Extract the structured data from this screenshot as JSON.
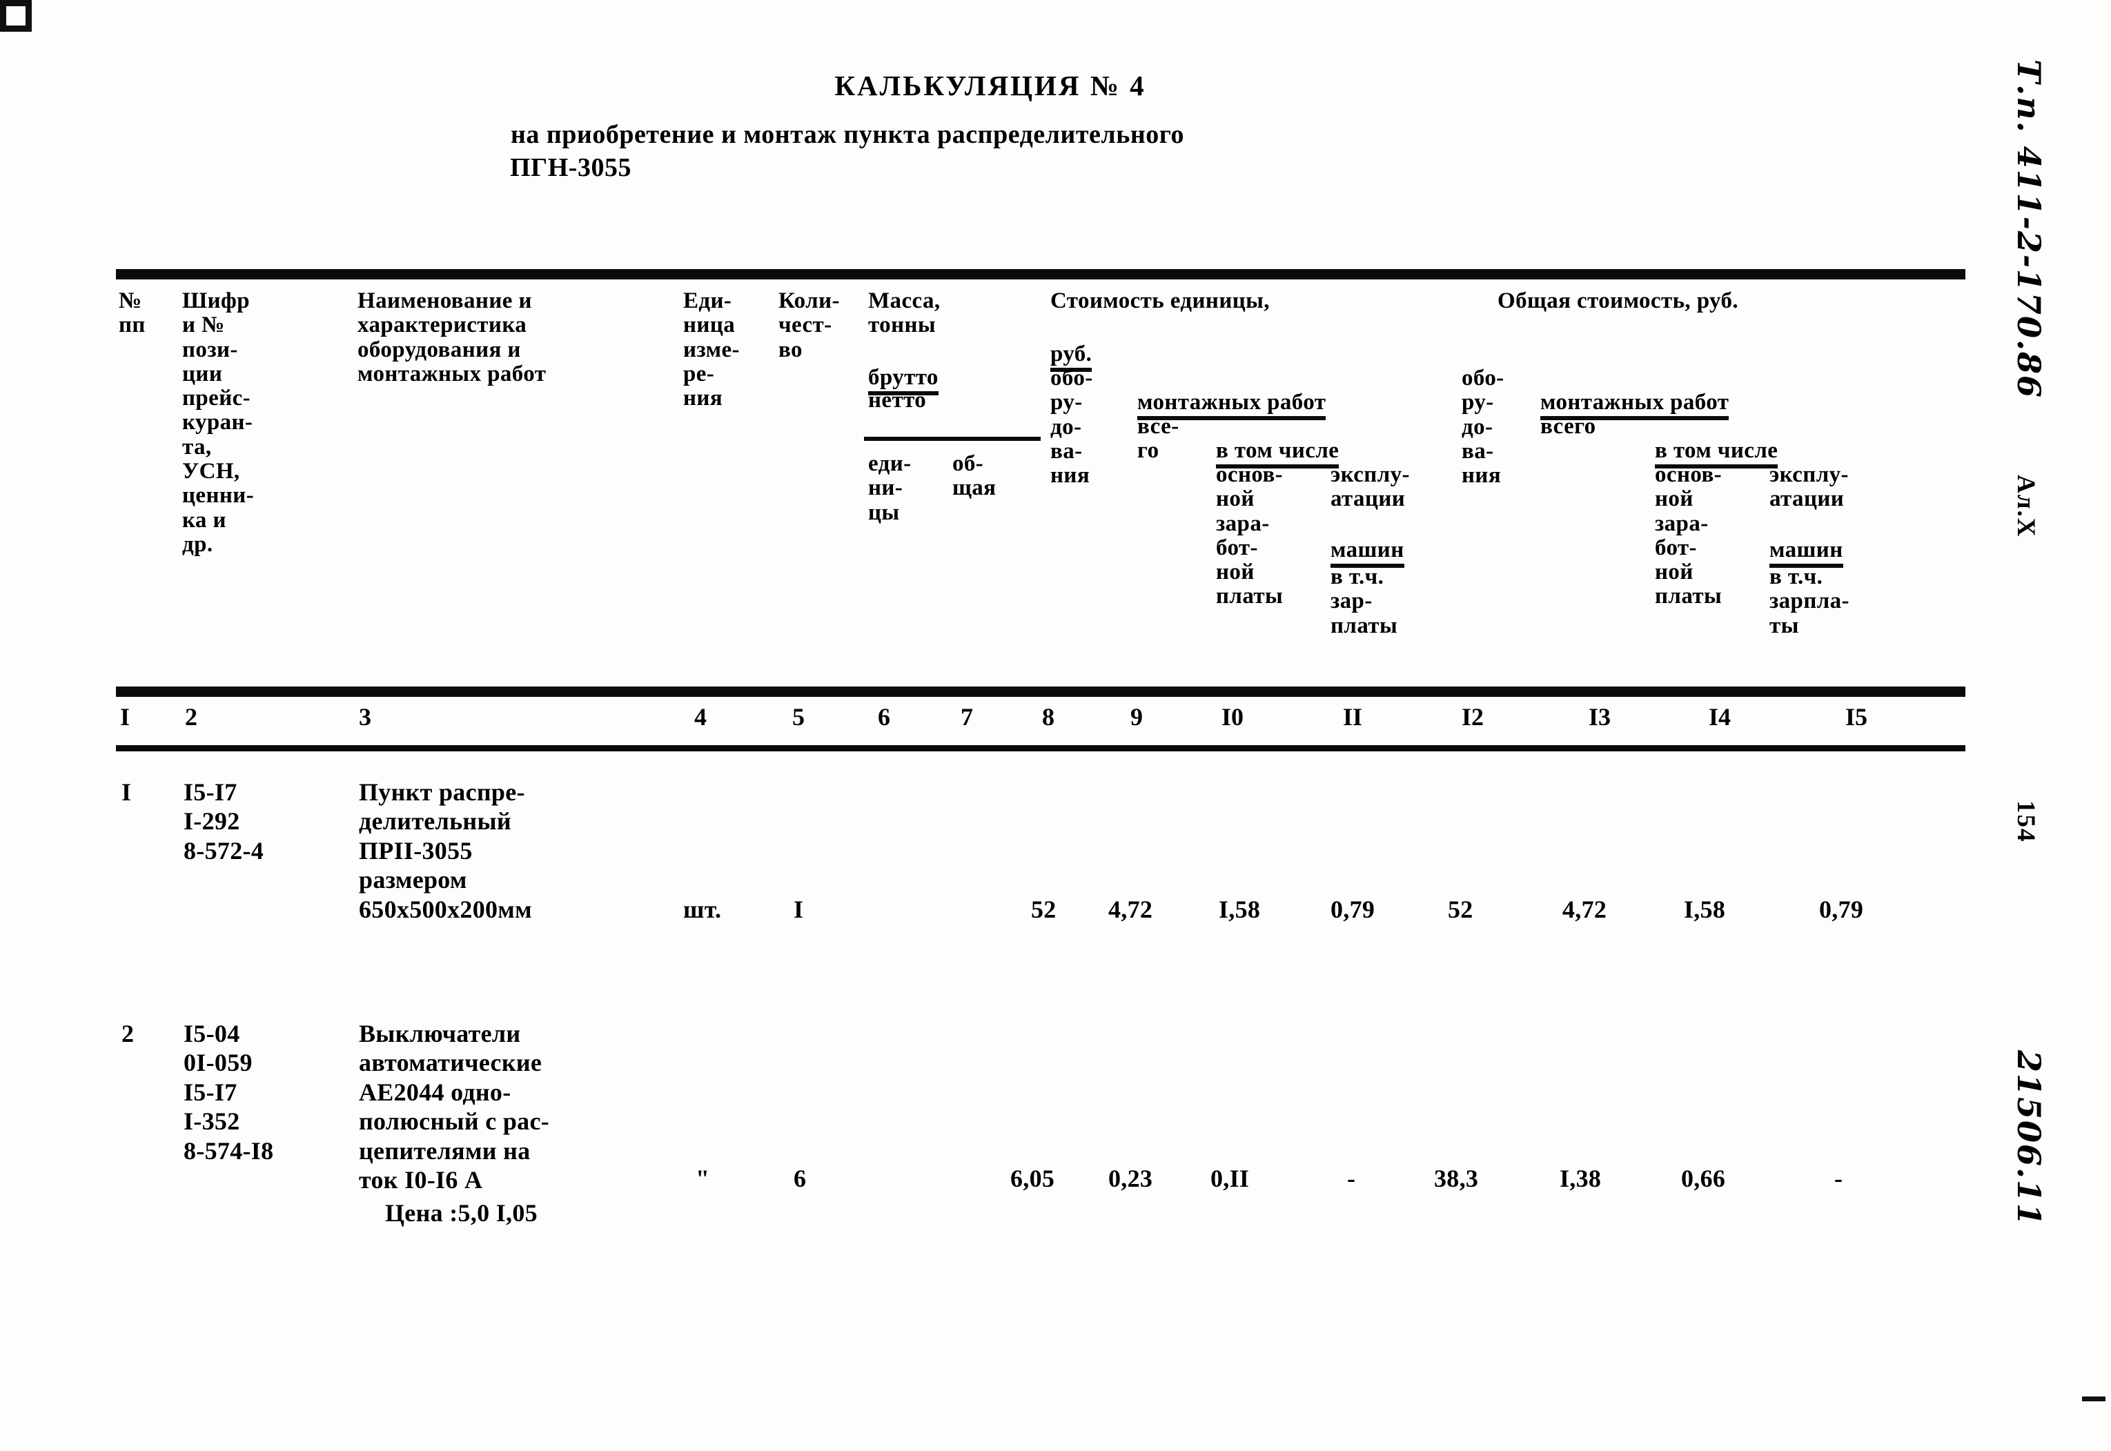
{
  "document": {
    "title": "КАЛЬКУЛЯЦИЯ № 4",
    "subtitle_line1": "на приобретение и монтаж пункта распределительного",
    "subtitle_line2": "ПГН-3055"
  },
  "margin": {
    "top_right_handwritten": "Т.п. 411-2-170.86",
    "top_right_sheet": "Ал.Х",
    "page_number": "154",
    "bottom_right_handwritten": "21506.11"
  },
  "table": {
    "headers": {
      "col1": "№\nпп",
      "col2": "Шифр\nи №\nпози-\nции\nпрейс-\nкуран-\nта,\nУСН,\nценни-\nка и\nдр.",
      "col3": "Наименование и\nхарактеристика\nоборудования и\nмонтажных работ",
      "col4": "Еди-\nница\nизме-\nре-\nния",
      "col5": "Коли-\nчест-\nво",
      "col6_group": "Масса,\nтонны",
      "col6_brutto": "брутто",
      "col6_netto": "нетто",
      "col6_edinicy": "еди-\nни-\nцы",
      "col7_obschaya": "об-\nщая",
      "unit_cost_group": "Стоимость единицы,",
      "unit_cost_group_rub": "руб.",
      "col8": "обо-\nру-\nдо-\nва-\nния",
      "montazh_unit": "монтажных работ",
      "col9": "все-\nго",
      "v_tom_chisle_unit": "в том числе",
      "col10": "основ-\nной\nзара-\nбот-\nной\nплаты",
      "col11_line1": "эксплу-\nатации",
      "col11_line2": "машин",
      "col11_line3": "в т.ч.\nзар-\nплаты",
      "total_cost_group": "Общая стоимость, руб.",
      "col12": "обо-\nру-\nдо-\nва-\nния",
      "montazh_total": "монтажных работ",
      "col13": "всего",
      "v_tom_chisle_total": "в том числе",
      "col14": "основ-\nной\nзара-\nбот-\nной\nплаты",
      "col15_line1": "эксплу-\nатации",
      "col15_line2": "машин",
      "col15_line3": "в т.ч.\nзарпла-\nты"
    },
    "column_numbers": [
      "I",
      "2",
      "3",
      "4",
      "5",
      "6",
      "7",
      "8",
      "9",
      "I0",
      "II",
      "I2",
      "I3",
      "I4",
      "I5"
    ],
    "rows": [
      {
        "no": "I",
        "code": "I5-I7\nI-292\n8-572-4",
        "name": "Пункт распре-\nделительный\nПРII-3055\nразмером\n650х500х200мм",
        "unit": "шт.",
        "qty": "I",
        "mass_brutto": "",
        "mass_netto": "",
        "c8": "52",
        "c9": "4,72",
        "c10": "I,58",
        "c11": "0,79",
        "c12": "52",
        "c13": "4,72",
        "c14": "I,58",
        "c15": "0,79"
      },
      {
        "no": "2",
        "code": "I5-04\n0I-059\nI5-I7\nI-352\n8-574-I8",
        "name": "Выключатели\nавтоматические\nАЕ2044 одно-\nполюсный с рас-\nцепителями на\nток I0-I6 А",
        "price_note": "Цена :5,0 I,05",
        "unit": "\"",
        "qty": "6",
        "mass_brutto": "",
        "mass_netto": "",
        "c8": "6,05",
        "c9": "0,23",
        "c10": "0,II",
        "c11": "-",
        "c12": "38,3",
        "c13": "I,38",
        "c14": "0,66",
        "c15": "-"
      }
    ]
  }
}
